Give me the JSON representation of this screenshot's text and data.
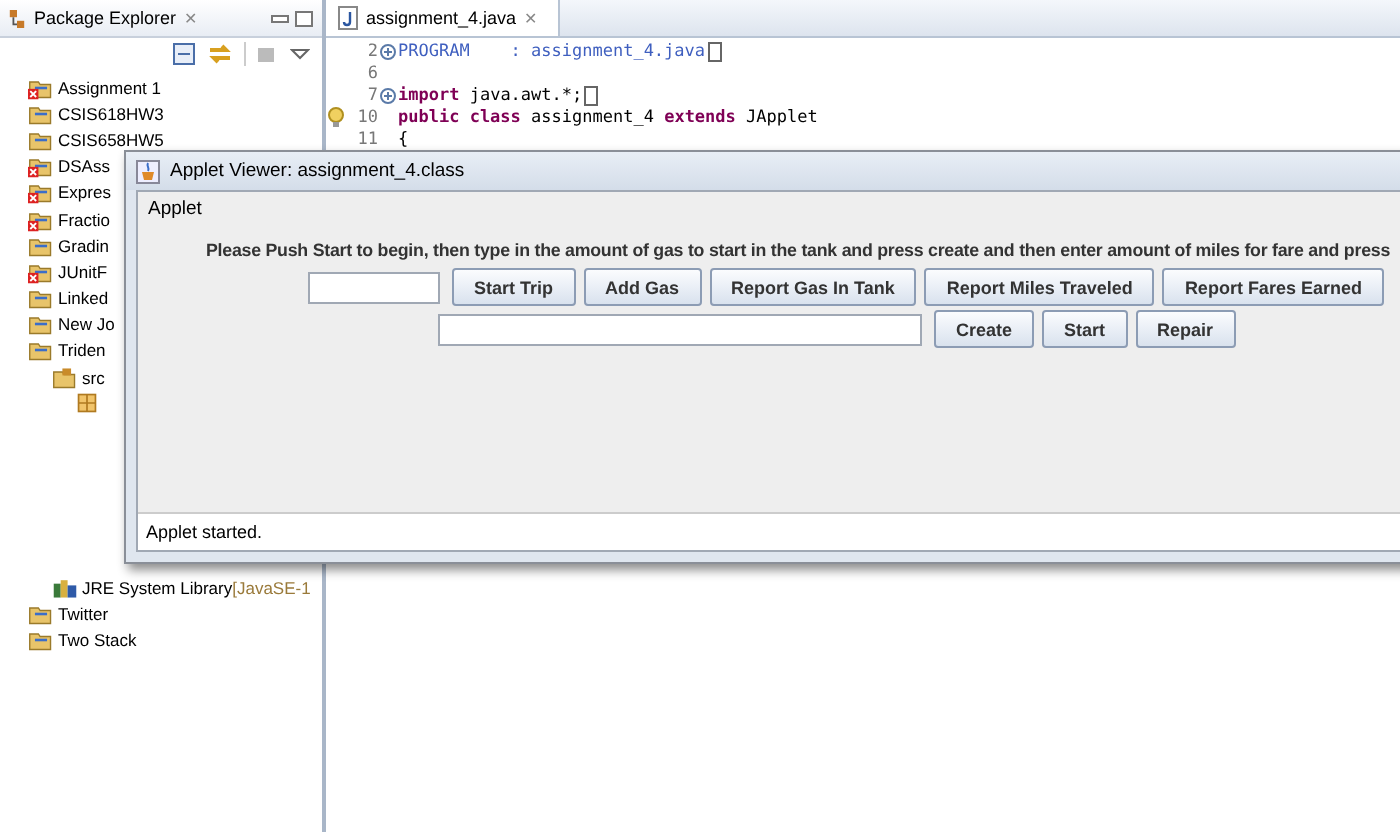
{
  "package_explorer": {
    "title": "Package Explorer",
    "close": "✕",
    "tree": [
      {
        "label": "Assignment 1",
        "kind": "project",
        "error": true
      },
      {
        "label": "CSIS618HW3",
        "kind": "project",
        "error": false
      },
      {
        "label": "CSIS658HW5",
        "kind": "project",
        "error": false
      },
      {
        "label": "DSAss",
        "kind": "project",
        "error": true
      },
      {
        "label": "Expres",
        "kind": "project",
        "error": true
      },
      {
        "label": "Fractio",
        "kind": "project",
        "error": true
      },
      {
        "label": "Gradin",
        "kind": "project",
        "error": false
      },
      {
        "label": "JUnitF",
        "kind": "project",
        "error": true
      },
      {
        "label": "Linked",
        "kind": "project",
        "error": false
      },
      {
        "label": "New Jo",
        "kind": "project",
        "error": false
      },
      {
        "label": "Triden",
        "kind": "project",
        "error": false,
        "children": [
          {
            "label": "src",
            "kind": "folder",
            "children": [
              {
                "kind": "package"
              }
            ]
          },
          {
            "label": "JRE System Library",
            "suffix": "[JavaSE-1",
            "kind": "library"
          }
        ]
      },
      {
        "label": "Twitter",
        "kind": "project",
        "error": false
      },
      {
        "label": "Two Stack",
        "kind": "project",
        "error": false
      }
    ]
  },
  "editor": {
    "tab": {
      "label": "assignment_4.java",
      "close": "✕",
      "selected": true
    },
    "lines": [
      {
        "number": "2",
        "fold": true,
        "warning": false,
        "folded": true,
        "tokens": [
          {
            "kind": "comment",
            "text": "PROGRAM    : assignment_4.java"
          }
        ]
      },
      {
        "number": "6",
        "fold": false,
        "warning": false,
        "folded": false
      },
      {
        "number": "7",
        "fold": true,
        "warning": false,
        "folded": true,
        "tokens": [
          {
            "kind": "keyword",
            "text": "import"
          },
          {
            "kind": "plain",
            "text": " java.awt.*;"
          }
        ]
      },
      {
        "number": "10",
        "fold": false,
        "warning": true,
        "folded": false,
        "tokens": [
          {
            "kind": "keyword",
            "text": "public class"
          },
          {
            "kind": "plain",
            "text": " assignment_4 "
          },
          {
            "kind": "keyword",
            "text": "extends"
          },
          {
            "kind": "plain",
            "text": " JApplet"
          }
        ]
      },
      {
        "number": "11",
        "fold": false,
        "warning": false,
        "folded": false,
        "tokens": [
          {
            "kind": "plain",
            "text": "{"
          }
        ]
      }
    ]
  },
  "applet_viewer": {
    "title": "Applet Viewer: assignment_4.class",
    "menu": "Applet",
    "instructions": "Please Push Start to begin, then type in the amount of gas to start in the tank and press create and then enter amount of miles for fare and press",
    "row_1": [
      {
        "kind": "field"
      },
      {
        "kind": "button",
        "label": "Start Trip"
      },
      {
        "kind": "button",
        "label": "Add Gas"
      },
      {
        "kind": "button",
        "label": "Report Gas In Tank"
      },
      {
        "kind": "button",
        "label": "Report Miles Traveled"
      },
      {
        "kind": "button",
        "label": "Report Fares Earned"
      }
    ],
    "row_2": [
      {
        "kind": "wide_field"
      },
      {
        "kind": "button",
        "label": "Create"
      },
      {
        "kind": "button",
        "label": "Start"
      },
      {
        "kind": "button",
        "label": "Repair"
      }
    ],
    "status": "Applet started."
  }
}
